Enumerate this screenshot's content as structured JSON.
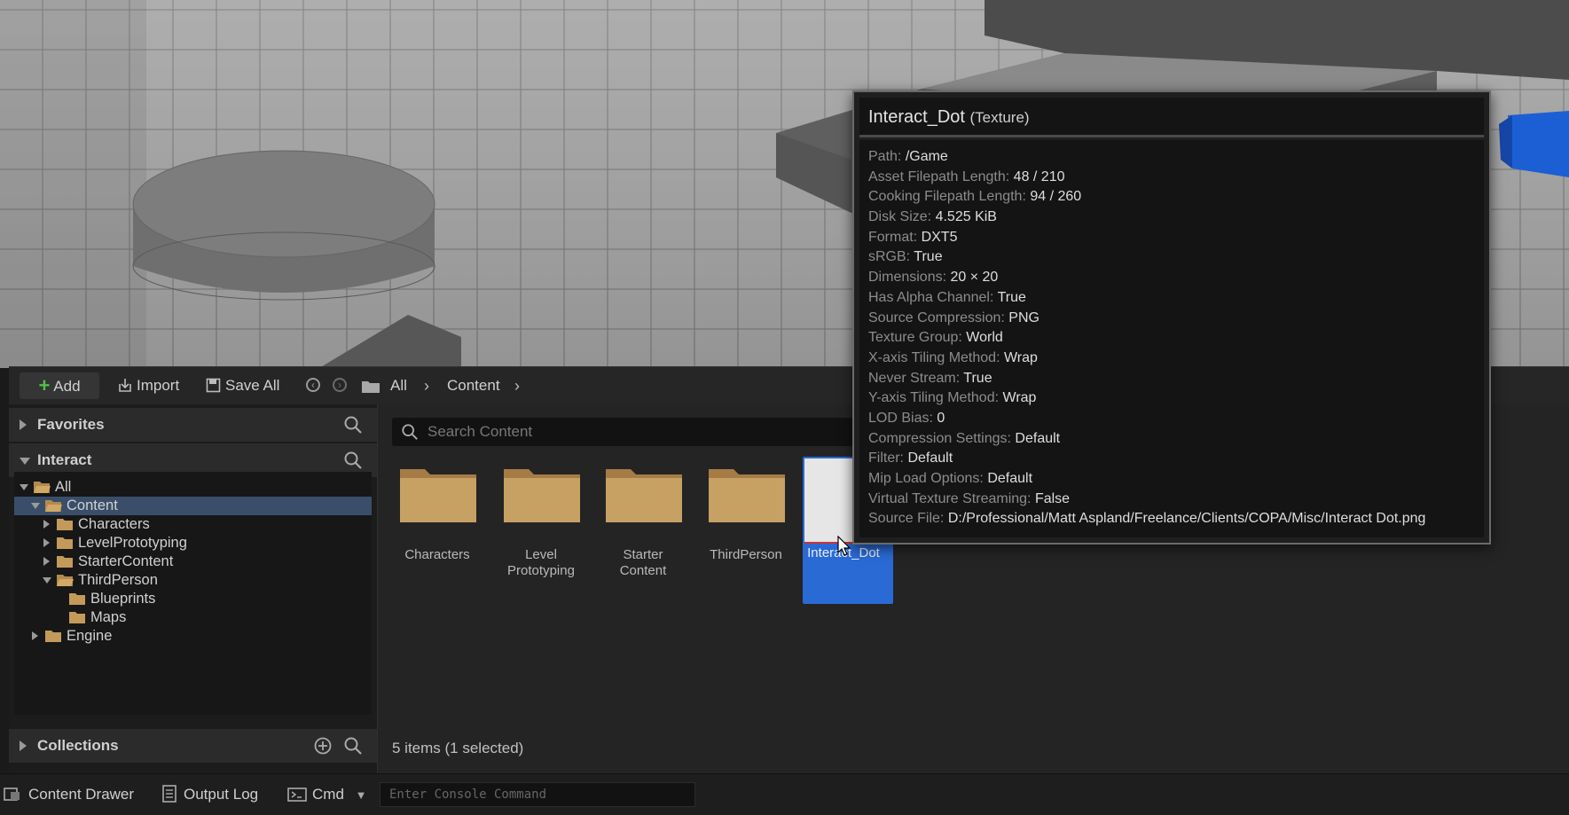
{
  "tooltip": {
    "asset_name": "Interact_Dot",
    "asset_type": "(Texture)",
    "properties": [
      {
        "key": "Path:",
        "value": "/Game"
      },
      {
        "key": "Asset Filepath Length:",
        "value": "48 / 210"
      },
      {
        "key": "Cooking Filepath Length:",
        "value": "94 / 260"
      },
      {
        "key": "Disk Size:",
        "value": "4.525 KiB"
      },
      {
        "key": "Format:",
        "value": "DXT5"
      },
      {
        "key": "sRGB:",
        "value": "True"
      },
      {
        "key": "Dimensions:",
        "value": "20 × 20"
      },
      {
        "key": "Has Alpha Channel:",
        "value": "True"
      },
      {
        "key": "Source Compression:",
        "value": "PNG"
      },
      {
        "key": "Texture Group:",
        "value": "World"
      },
      {
        "key": "X-axis Tiling Method:",
        "value": "Wrap"
      },
      {
        "key": "Never Stream:",
        "value": "True"
      },
      {
        "key": "Y-axis Tiling Method:",
        "value": "Wrap"
      },
      {
        "key": "LOD Bias:",
        "value": "0"
      },
      {
        "key": "Compression Settings:",
        "value": "Default"
      },
      {
        "key": "Filter:",
        "value": "Default"
      },
      {
        "key": "Mip Load Options:",
        "value": "Default"
      },
      {
        "key": "Virtual Texture Streaming:",
        "value": "False"
      },
      {
        "key": "Source File:",
        "value": "D:/Professional/Matt Aspland/Freelance/Clients/COPA/Misc/Interact Dot.png"
      }
    ]
  },
  "toolbar": {
    "add_label": "Add",
    "import_label": "Import",
    "save_all_label": "Save All",
    "breadcrumbs": [
      "All",
      "Content"
    ]
  },
  "sidebar": {
    "favorites_label": "Favorites",
    "project_label": "Interact",
    "collections_label": "Collections",
    "tree": [
      {
        "label": "All"
      },
      {
        "label": "Content"
      },
      {
        "label": "Characters"
      },
      {
        "label": "LevelPrototyping"
      },
      {
        "label": "StarterContent"
      },
      {
        "label": "ThirdPerson"
      },
      {
        "label": "Blueprints"
      },
      {
        "label": "Maps"
      },
      {
        "label": "Engine"
      }
    ]
  },
  "content": {
    "search_placeholder": "Search Content",
    "items": [
      {
        "label": "Characters"
      },
      {
        "label": "Level Prototyping"
      },
      {
        "label": "Starter Content"
      },
      {
        "label": "ThirdPerson"
      },
      {
        "label": "Interact_Dot"
      }
    ],
    "status": "5 items (1 selected)"
  },
  "bottombar": {
    "content_drawer": "Content Drawer",
    "output_log": "Output Log",
    "cmd": "Cmd",
    "console_placeholder": "Enter Console Command"
  },
  "colors": {
    "accent_selection": "#2a6ad4",
    "tree_selection": "#3a4e6a",
    "folder": "#c49a5a",
    "add_icon": "#4fc04f"
  }
}
